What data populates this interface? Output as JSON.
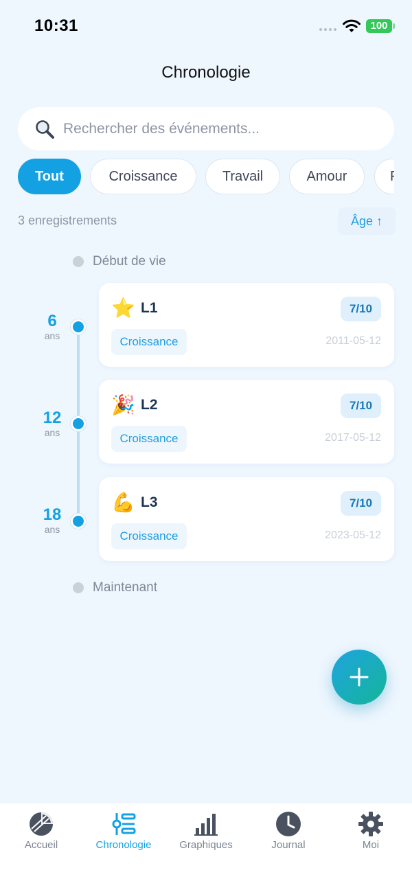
{
  "status_bar": {
    "time": "10:31",
    "battery": "100"
  },
  "header": {
    "title": "Chronologie"
  },
  "search": {
    "placeholder": "Rechercher des événements..."
  },
  "filters": [
    {
      "label": "Tout",
      "active": true
    },
    {
      "label": "Croissance",
      "active": false
    },
    {
      "label": "Travail",
      "active": false
    },
    {
      "label": "Amour",
      "active": false
    },
    {
      "label": "F",
      "active": false
    }
  ],
  "summary": {
    "count_text": "3 enregistrements",
    "sort_label": "Âge ↑"
  },
  "timeline": {
    "start_label": "Début de vie",
    "end_label": "Maintenant",
    "events": [
      {
        "age": "6",
        "age_unit": "ans",
        "emoji": "⭐",
        "title": "L1",
        "score": "7/10",
        "category": "Croissance",
        "date": "2011-05-12"
      },
      {
        "age": "12",
        "age_unit": "ans",
        "emoji": "🎉",
        "title": "L2",
        "score": "7/10",
        "category": "Croissance",
        "date": "2017-05-12"
      },
      {
        "age": "18",
        "age_unit": "ans",
        "emoji": "💪",
        "title": "L3",
        "score": "7/10",
        "category": "Croissance",
        "date": "2023-05-12"
      }
    ]
  },
  "tab_bar": {
    "items": [
      {
        "label": "Accueil",
        "icon": "pie-chart-icon",
        "active": false
      },
      {
        "label": "Chronologie",
        "icon": "timeline-icon",
        "active": true
      },
      {
        "label": "Graphiques",
        "icon": "bar-chart-icon",
        "active": false
      },
      {
        "label": "Journal",
        "icon": "clock-icon",
        "active": false
      },
      {
        "label": "Moi",
        "icon": "gear-icon",
        "active": false
      }
    ]
  },
  "colors": {
    "accent": "#13a1e4",
    "background": "#eef6fe",
    "fab_end": "#15b59a"
  }
}
